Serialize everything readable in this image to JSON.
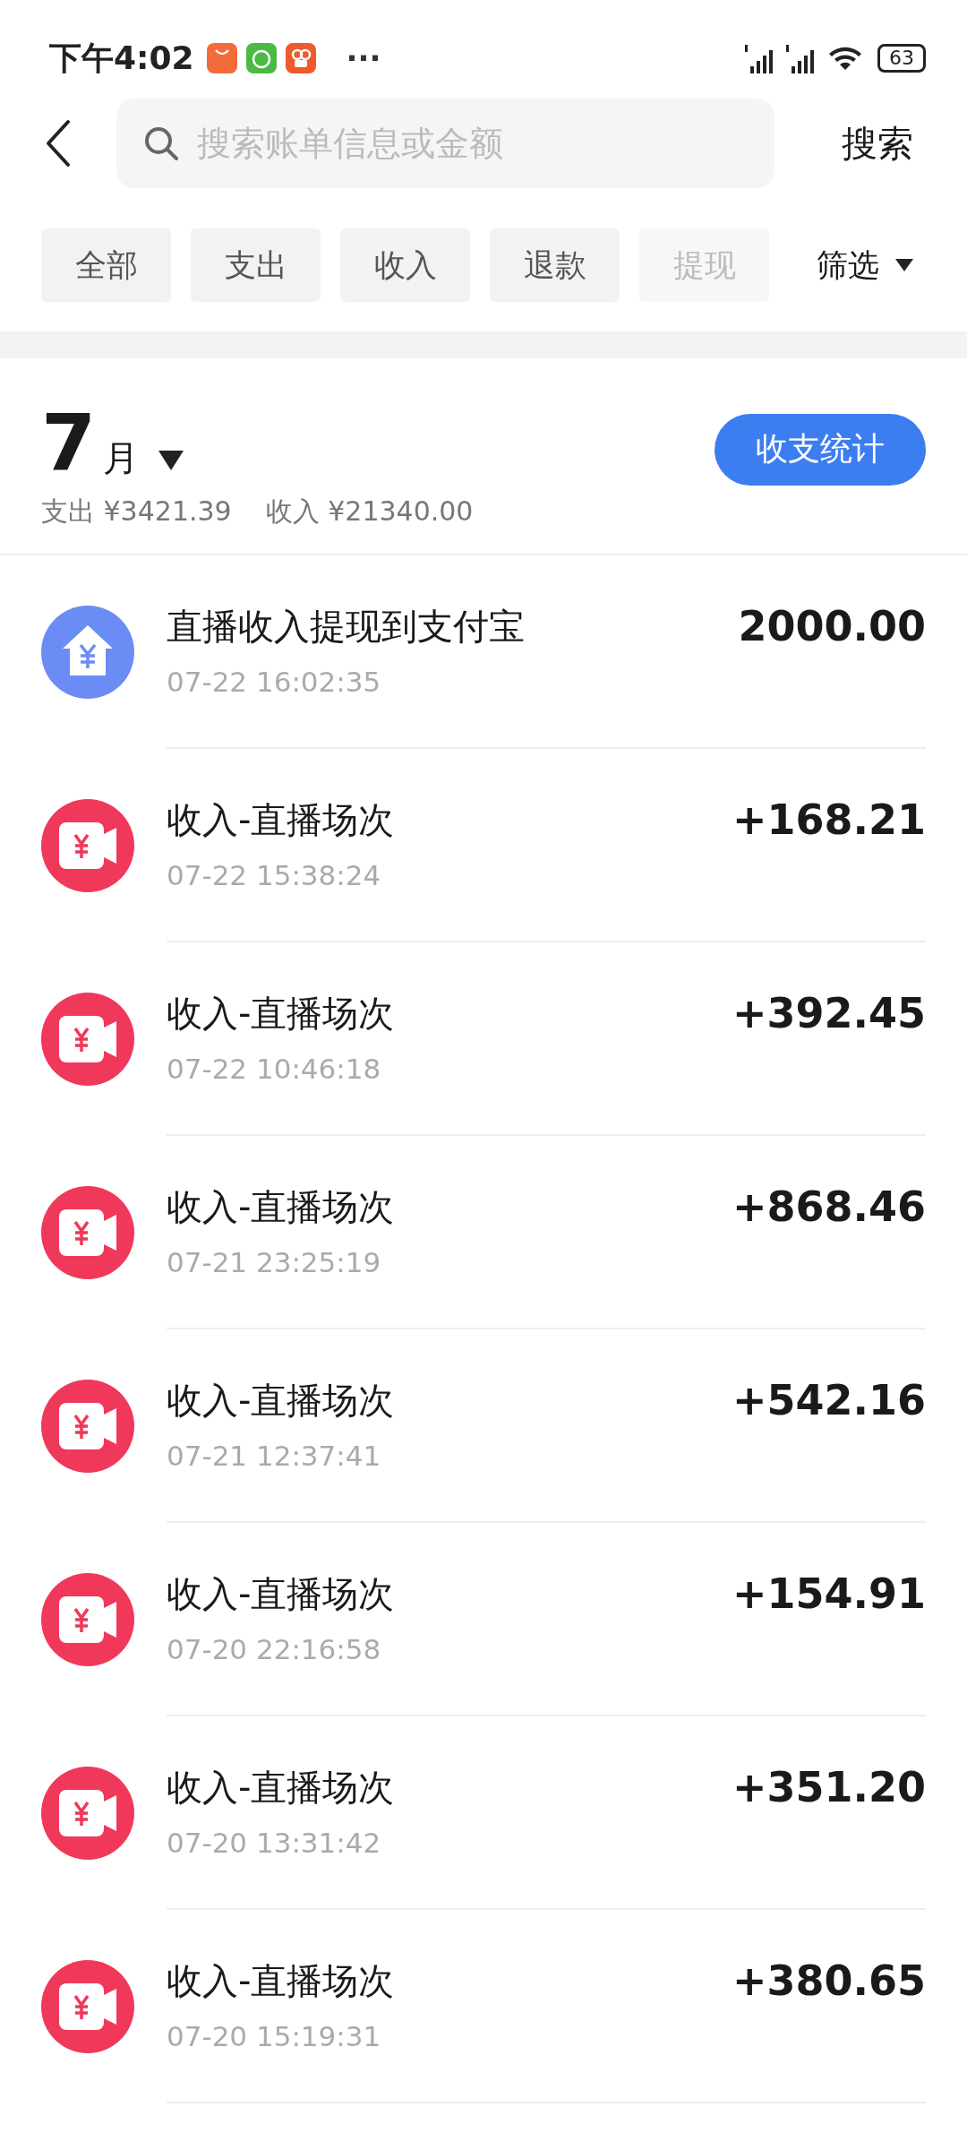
{
  "status_bar": {
    "time": "下午4:02",
    "more": "···",
    "battery": "63"
  },
  "search": {
    "placeholder": "搜索账单信息或金额",
    "button": "搜索"
  },
  "tabs": [
    {
      "label": "全部",
      "selected": false,
      "faded": false
    },
    {
      "label": "支出",
      "selected": false,
      "faded": false
    },
    {
      "label": "收入",
      "selected": false,
      "faded": false
    },
    {
      "label": "退款",
      "selected": false,
      "faded": false
    },
    {
      "label": "提现",
      "selected": false,
      "faded": true
    }
  ],
  "filter": {
    "label": "筛选"
  },
  "month": {
    "number": "7",
    "unit": "月",
    "expense": "支出 ¥3421.39",
    "income": "收入 ¥21340.00",
    "stats_button": "收支统计"
  },
  "transactions": [
    {
      "kind": "withdraw",
      "title": "直播收入提现到支付宝",
      "time": "07-22 16:02:35",
      "amount": "2000.00"
    },
    {
      "kind": "live",
      "title": "收入-直播场次",
      "time": "07-22 15:38:24",
      "amount": "+168.21"
    },
    {
      "kind": "live",
      "title": "收入-直播场次",
      "time": "07-22 10:46:18",
      "amount": "+392.45"
    },
    {
      "kind": "live",
      "title": "收入-直播场次",
      "time": "07-21 23:25:19",
      "amount": "+868.46"
    },
    {
      "kind": "live",
      "title": "收入-直播场次",
      "time": "07-21 12:37:41",
      "amount": "+542.16"
    },
    {
      "kind": "live",
      "title": "收入-直播场次",
      "time": "07-20 22:16:58",
      "amount": "+154.91"
    },
    {
      "kind": "live",
      "title": "收入-直播场次",
      "time": "07-20 13:31:42",
      "amount": "+351.20"
    },
    {
      "kind": "live",
      "title": "收入-直播场次",
      "time": "07-20 15:19:31",
      "amount": "+380.65"
    }
  ]
}
